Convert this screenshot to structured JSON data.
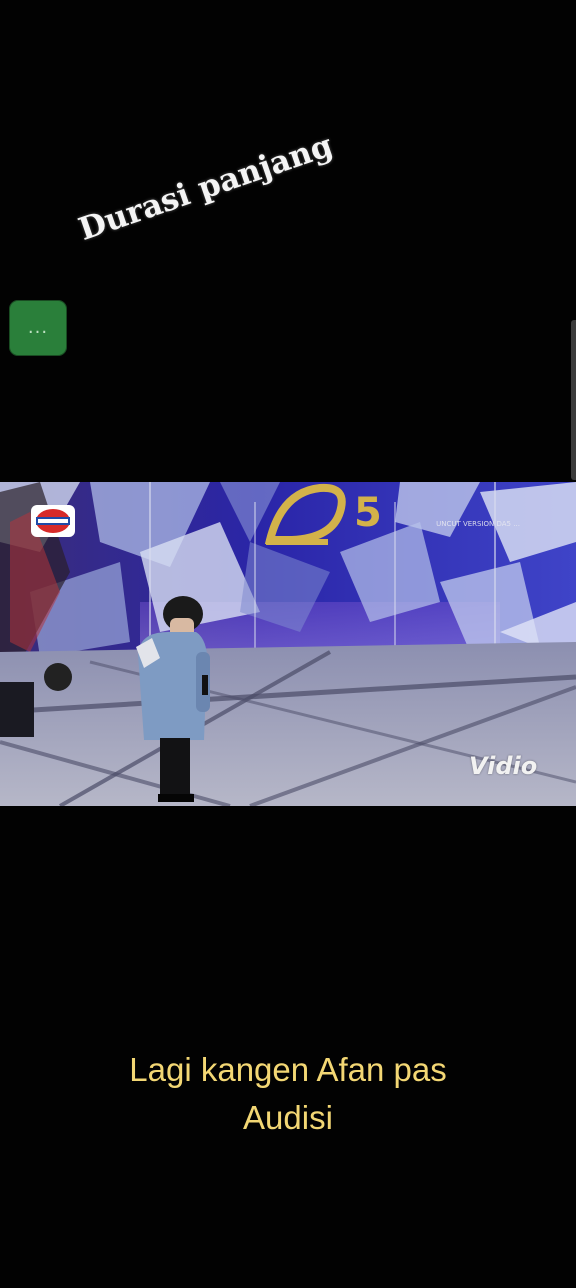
{
  "overlay_text": {
    "top_caption": "Durasi panjang",
    "more_button_label": "...",
    "bottom_caption_line1": "Lagi kangen Afan pas",
    "bottom_caption_line2": "Audisi"
  },
  "video": {
    "watermark": "Vidio",
    "channel_logo_label": "INDOSIAR",
    "uncut_label": "UNCUT VERSION DA5 ..."
  },
  "colors": {
    "background": "#020202",
    "top_caption": "#f4f4f4",
    "bottom_caption": "#f3d774",
    "more_button": "#2a7f3a"
  },
  "icons": {
    "more_button": "more-dots-icon",
    "channel_logo": "indosiar-logo-icon",
    "show_badge": "da5-logo-icon"
  }
}
